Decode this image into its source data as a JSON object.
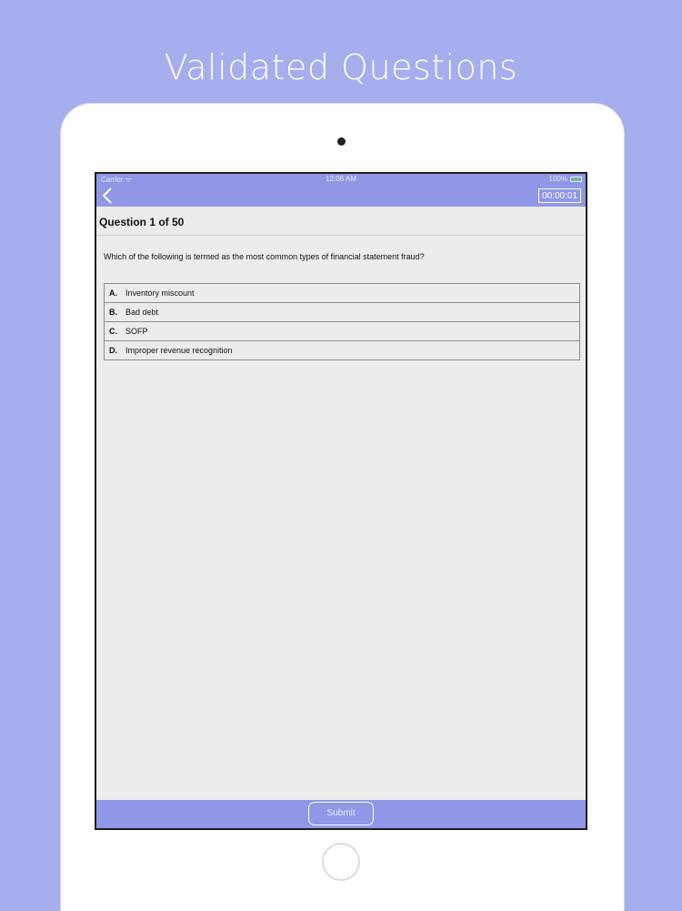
{
  "promo": {
    "title": "Validated Questions"
  },
  "status_bar": {
    "carrier": "Carrier ᯤ",
    "time": "12:06 AM",
    "battery": "100%"
  },
  "nav": {
    "back_icon": "chevron-left-icon",
    "timer": "00:00:01"
  },
  "question": {
    "header": "Question 1 of 50",
    "text": "Which of the following is termed as the most common types of financial statement fraud?",
    "options": [
      {
        "letter": "A.",
        "text": "Inventory miscount"
      },
      {
        "letter": "B.",
        "text": "Bad debt"
      },
      {
        "letter": "C.",
        "text": "SOFP"
      },
      {
        "letter": "D.",
        "text": "Improper revenue recognition"
      }
    ]
  },
  "footer": {
    "submit_label": "Submit"
  },
  "colors": {
    "background": "#a6aeee",
    "nav_bar": "#8f97e6",
    "screen": "#ececec"
  }
}
